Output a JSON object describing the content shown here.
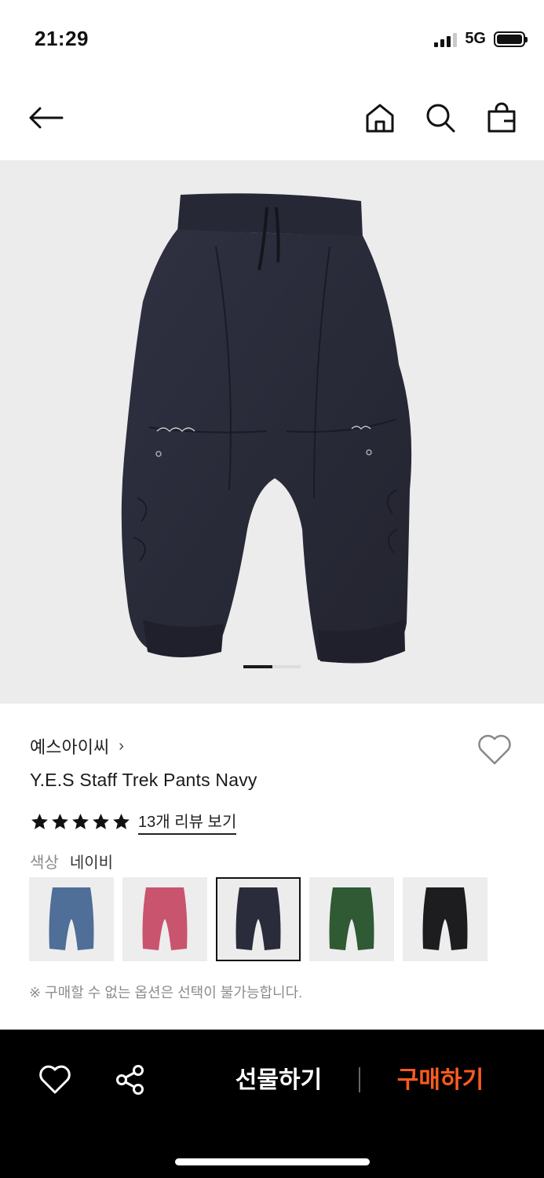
{
  "status": {
    "time": "21:29",
    "network": "5G"
  },
  "nav": {
    "icons": [
      "back-arrow-icon",
      "home-icon",
      "search-icon",
      "shopping-bag-icon"
    ]
  },
  "gallery": {
    "current_page": 1,
    "total_pages": 2
  },
  "product": {
    "brand": "예스아이씨",
    "brand_chevron": "›",
    "name": "Y.E.S Staff Trek Pants Navy",
    "rating_stars": 5,
    "review_link": "13개 리뷰 보기",
    "color_label": "색상",
    "color_value": "네이비",
    "swatches": [
      {
        "name": "blue",
        "color": "#4f6e98",
        "selected": false
      },
      {
        "name": "pink",
        "color": "#c9546e",
        "selected": false
      },
      {
        "name": "navy",
        "color": "#2a2c3b",
        "selected": true
      },
      {
        "name": "green",
        "color": "#2f5a34",
        "selected": false
      },
      {
        "name": "black",
        "color": "#1d1d1f",
        "selected": false
      }
    ],
    "notice": "※ 구매할 수 없는 옵션은 선택이 불가능합니다."
  },
  "actions": {
    "gift_label": "선물하기",
    "buy_label": "구매하기",
    "buy_color": "#ff5a1f"
  }
}
